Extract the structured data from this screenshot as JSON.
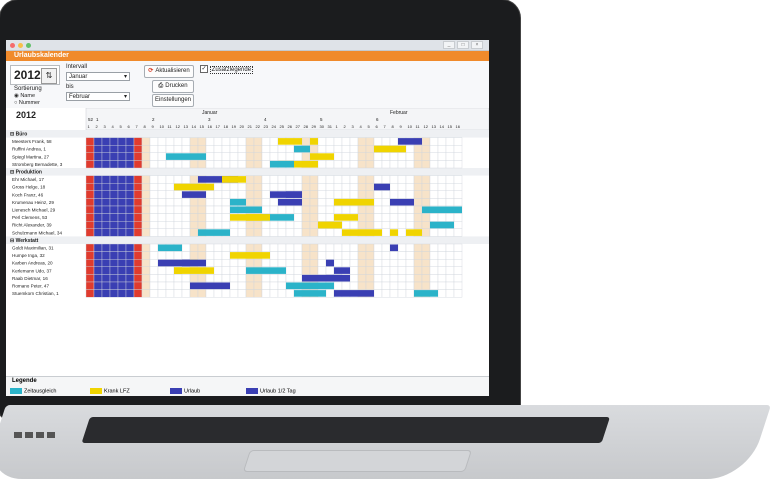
{
  "window": {
    "title": "Urlaubskalender",
    "buttons": [
      "_",
      "□",
      "×"
    ]
  },
  "controls": {
    "year": "2012",
    "interval_label": "Intervall",
    "from_month": "Januar",
    "to_label": "bis",
    "to_month": "Februar",
    "sort_label": "Sortierung",
    "sort_options": [
      "Name",
      "Nummer"
    ],
    "refresh_label": "Aktualisieren",
    "print_label": "Drucken",
    "settings_label": "Einstellungen",
    "legend_checkbox_label": "Zusatzlegende"
  },
  "calendar": {
    "year": "2012",
    "months": [
      "Januar",
      "Februar"
    ],
    "weeks": [
      "52",
      "1",
      "2",
      "3",
      "4",
      "5",
      "6"
    ],
    "days_jan": 31,
    "days_feb": 16,
    "groups": [
      {
        "name": "Büro",
        "people": [
          "Meesters Frank, 58",
          "Ruffini Andrea, 1",
          "Spiegl Martina, 27",
          "Stromberg Bernadette, 3"
        ]
      },
      {
        "name": "Produktion",
        "people": [
          "Ehr Michael, 17",
          "Gross Helge, 18",
          "Koch Franz, 46",
          "Krumenau Heinz, 29",
          "Lienesch Michael, 29",
          "Perl Clemens, 53",
          "Richt Alexander, 39",
          "Schulzmann Michael, 34"
        ]
      },
      {
        "name": "Werkstatt",
        "people": [
          "Goldt Maximilian, 31",
          "Humpe Inga, 32",
          "Karben Andreas, 20",
          "Kerlemann Udo, 37",
          "Raab Dietmar, 16",
          "Romano Peter, 47",
          "Stuemkorn Christian, 1"
        ]
      }
    ]
  },
  "legend": {
    "title": "Legende",
    "items": [
      {
        "label": "Zeitausgleich",
        "color": "#2bb3c9"
      },
      {
        "label": "Krank LFZ",
        "color": "#f0d400"
      },
      {
        "label": "Urlaub",
        "color": "#3a3fb3"
      },
      {
        "label": "Urlaub 1/2 Tag",
        "color": "#3a3fb3"
      }
    ]
  },
  "colors": {
    "accent": "#f08a2b",
    "holiday_red": "#e03b2e",
    "vacation_blue": "#3a3fb3",
    "sick_yellow": "#f0d400",
    "comp_cyan": "#2bb3c9",
    "weekend": "#f7e3c9"
  }
}
